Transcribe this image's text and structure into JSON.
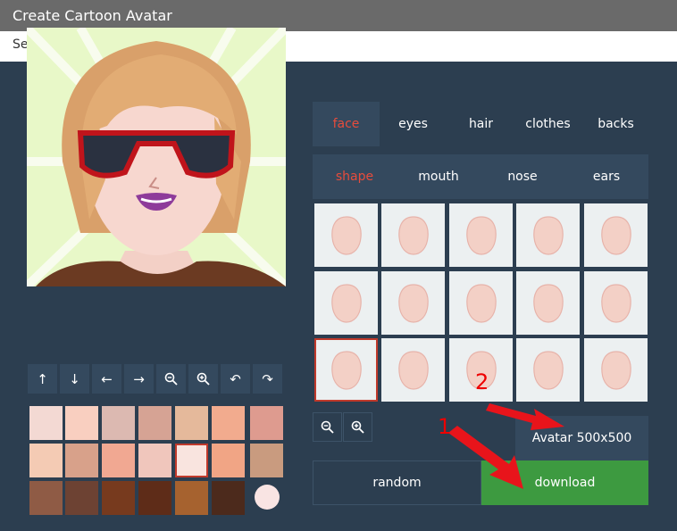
{
  "header": {
    "title": "Create Cartoon Avatar",
    "subtitle": "Select your avatar gender below to begin."
  },
  "tabs": [
    {
      "label": "face",
      "active": true
    },
    {
      "label": "eyes",
      "active": false
    },
    {
      "label": "hair",
      "active": false
    },
    {
      "label": "clothes",
      "active": false
    },
    {
      "label": "backs",
      "active": false
    }
  ],
  "subtabs": [
    {
      "label": "shape",
      "active": true
    },
    {
      "label": "mouth",
      "active": false
    },
    {
      "label": "nose",
      "active": false
    },
    {
      "label": "ears",
      "active": false
    }
  ],
  "controls": [
    "arrow-up-icon",
    "arrow-down-icon",
    "arrow-left-icon",
    "arrow-right-icon",
    "zoom-out-icon",
    "zoom-in-icon",
    "undo-icon",
    "redo-icon"
  ],
  "colors": {
    "accent": "#e74c3c",
    "download": "#3d9a40",
    "panel": "#34495e",
    "background": "#2c3e50",
    "swatches": [
      "#f3d9d3",
      "#f9cfc0",
      "#dcb9b1",
      "#d6a394",
      "#e5b99b",
      "#f2ab8e",
      "#de9b8f",
      "#f4cbb4",
      "#d8a18a",
      "#f1a892",
      "#f0c6bc",
      "#f9e4df",
      "#f1a585",
      "#c99b7f",
      "#8f5b45",
      "#6d4233",
      "#773a1e",
      "#5e2c18",
      "#a6622f",
      "#4c2a1c",
      "#f9e4e3"
    ],
    "selected_swatch_index": 11
  },
  "shapes": {
    "selected_index": 10
  },
  "zoom_controls": [
    "zoom-out-icon",
    "zoom-in-icon"
  ],
  "actions": {
    "size_label": "Avatar 500x500",
    "random_label": "random",
    "download_label": "download"
  },
  "annotations": [
    "2",
    "1"
  ]
}
